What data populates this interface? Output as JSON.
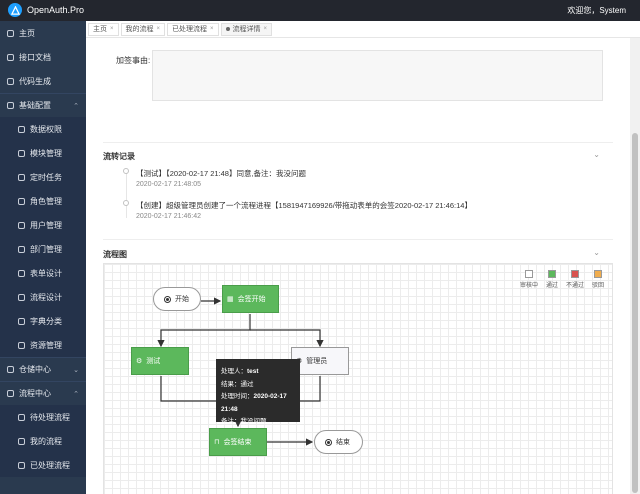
{
  "header": {
    "brand": "OpenAuth.Pro",
    "user": "欢迎您，System"
  },
  "sidebar": {
    "items": [
      {
        "label": "主页",
        "type": "top"
      },
      {
        "label": "接口文档",
        "type": "top"
      },
      {
        "label": "代码生成",
        "type": "top"
      },
      {
        "label": "基础配置",
        "type": "group",
        "caret": "⌃"
      },
      {
        "label": "数据权限",
        "type": "sub"
      },
      {
        "label": "模块管理",
        "type": "sub"
      },
      {
        "label": "定时任务",
        "type": "sub"
      },
      {
        "label": "角色管理",
        "type": "sub"
      },
      {
        "label": "用户管理",
        "type": "sub"
      },
      {
        "label": "部门管理",
        "type": "sub"
      },
      {
        "label": "表单设计",
        "type": "sub"
      },
      {
        "label": "流程设计",
        "type": "sub"
      },
      {
        "label": "字典分类",
        "type": "sub"
      },
      {
        "label": "资源管理",
        "type": "sub"
      },
      {
        "label": "仓储中心",
        "type": "group",
        "caret": "⌄"
      },
      {
        "label": "流程中心",
        "type": "group",
        "caret": "⌃"
      },
      {
        "label": "待处理流程",
        "type": "sub"
      },
      {
        "label": "我的流程",
        "type": "sub"
      },
      {
        "label": "已处理流程",
        "type": "sub"
      }
    ]
  },
  "tabs": [
    {
      "label": "主页",
      "close": "×"
    },
    {
      "label": "我的流程",
      "close": "×"
    },
    {
      "label": "已处理流程",
      "close": "×"
    },
    {
      "label": "流程详情",
      "close": "×"
    }
  ],
  "form": {
    "reason_label": "加签事由:"
  },
  "history": {
    "title": "流转记录",
    "caret": "⌄",
    "entries": [
      {
        "text": "【测试】【2020-02-17 21:48】同意,备注：我没问题",
        "time": "2020-02-17 21:48:05"
      },
      {
        "text": "【创建】超级管理员创建了一个流程进程【1581947169926/带拖动表单的会签2020-02-17 21:46:14】",
        "time": "2020-02-17 21:46:42"
      }
    ]
  },
  "flowchart": {
    "title": "流程图",
    "caret": "⌄",
    "legend": [
      {
        "label": "审核中",
        "color": "#ffffff"
      },
      {
        "label": "通过",
        "color": "#5cb85c"
      },
      {
        "label": "不通过",
        "color": "#d9534f"
      },
      {
        "label": "驳回",
        "color": "#f0ad4e"
      }
    ],
    "nodes": {
      "start": "开始",
      "countersign_start": "会签开始",
      "test": "测试",
      "admin": "管理员",
      "countersign_end": "会签结束",
      "end": "结束"
    },
    "tooltip": {
      "handler_label": "处理人：",
      "handler": "test",
      "result_label": "结果：",
      "result": "通过",
      "time_label": "处理时间：",
      "time": "2020-02-17 21:48",
      "note_label": "备注：",
      "note": "我没问题"
    }
  }
}
